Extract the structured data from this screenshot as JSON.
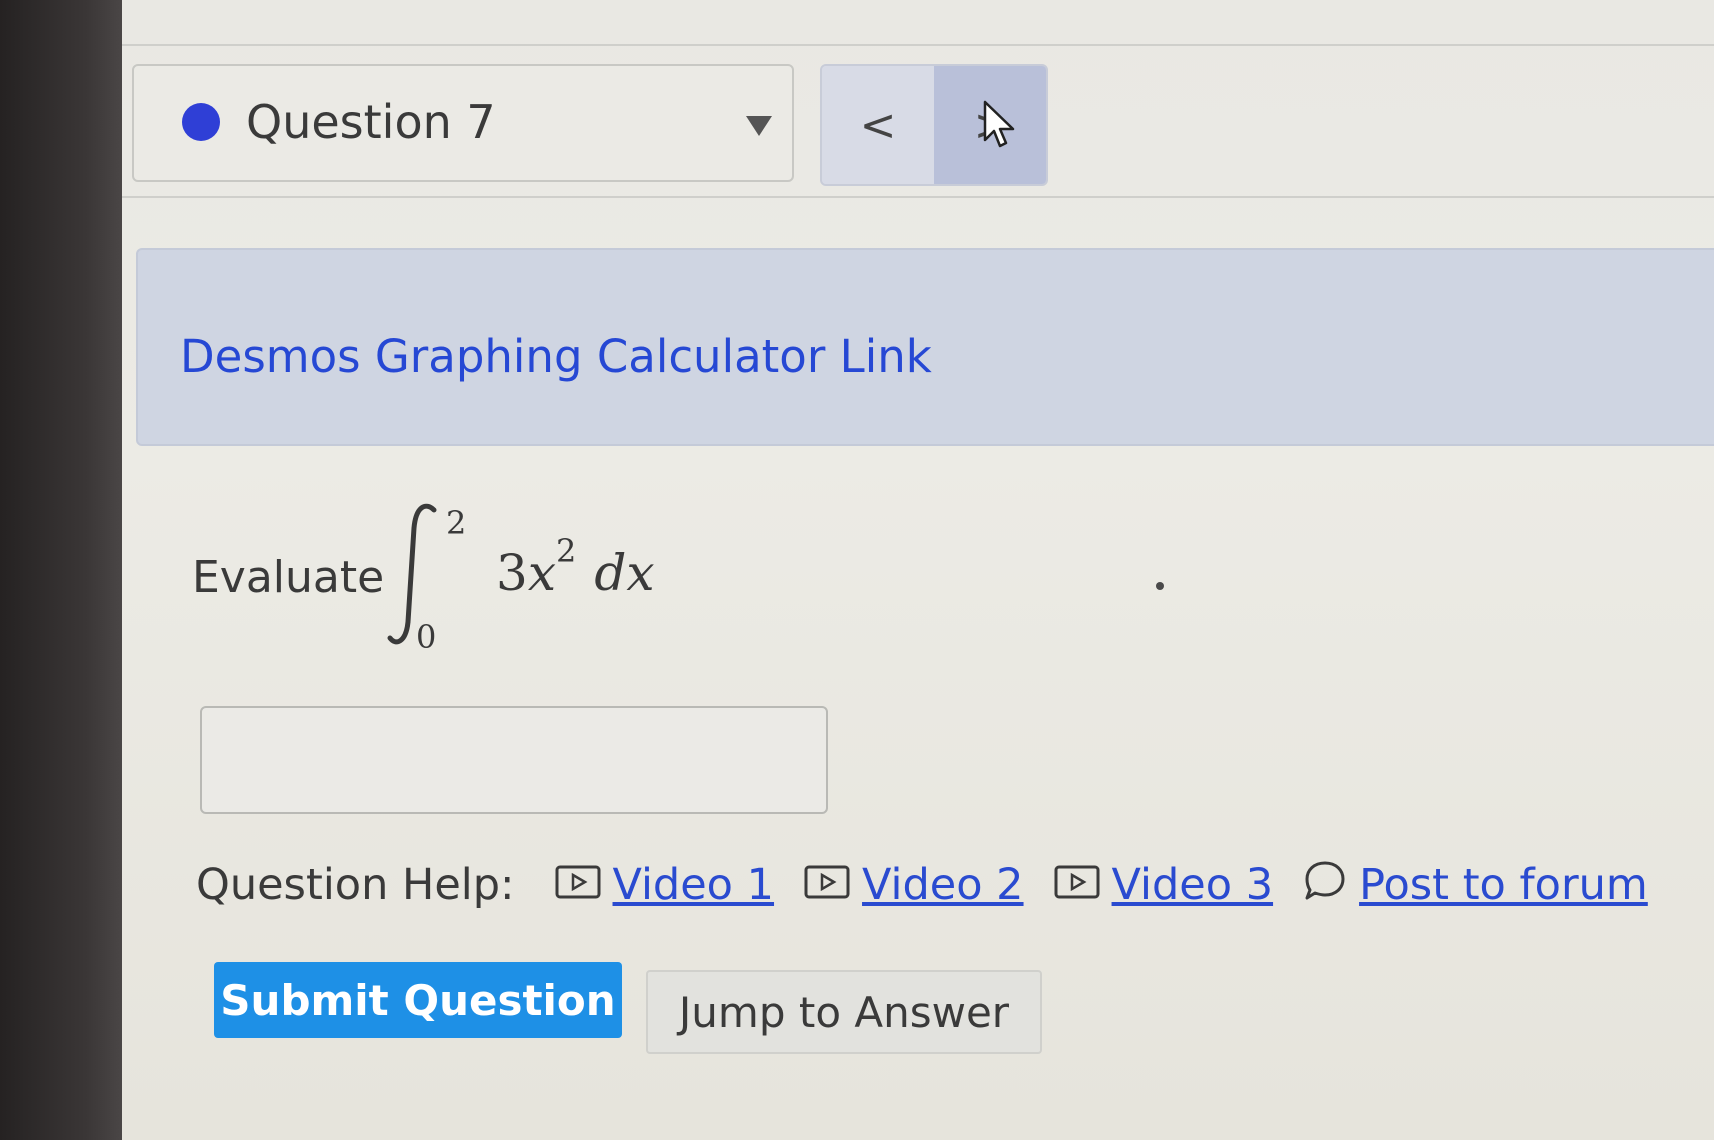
{
  "question_nav": {
    "label": "Question 7",
    "status_color": "#2f3fd6",
    "prev_symbol": "<",
    "next_symbol": ">"
  },
  "resource_box": {
    "link_text": "Desmos Graphing Calculator Link"
  },
  "problem": {
    "prompt": "Evaluate",
    "integral": {
      "lower_limit": "0",
      "upper_limit": "2",
      "coefficient": "3",
      "variable": "x",
      "exponent": "2",
      "differential": "dx"
    }
  },
  "answer": {
    "value": ""
  },
  "help": {
    "label": "Question Help:",
    "links": [
      {
        "label": "Video 1",
        "icon": "video-icon"
      },
      {
        "label": "Video 2",
        "icon": "video-icon"
      },
      {
        "label": "Video 3",
        "icon": "video-icon"
      },
      {
        "label": "Post to forum",
        "icon": "speech-bubble-icon"
      }
    ]
  },
  "actions": {
    "submit_label": "Submit Question",
    "jump_label": "Jump to Answer"
  },
  "colors": {
    "accent_blue": "#1e90e6",
    "link_blue": "#2a4bd0"
  }
}
